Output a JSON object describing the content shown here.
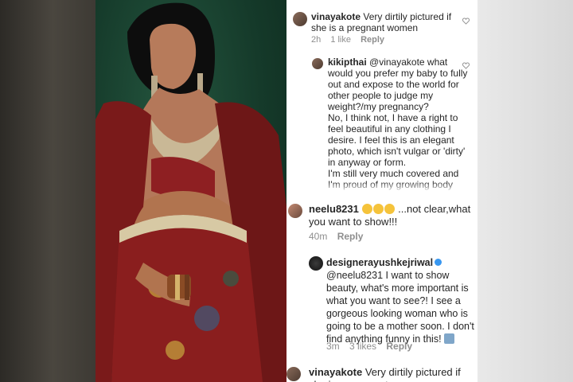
{
  "comments": [
    {
      "user": "vinayakote",
      "text": "Very dirtily pictured if she is a pregnant women",
      "time": "2h",
      "likes": "1 like",
      "reply": "Reply"
    },
    {
      "user": "kikipthai",
      "text": "@vinayakote what would you prefer my baby to fully out and expose to the world for other people to judge my weight?/my pregnancy?",
      "text2": "No, I think not, I have a right to feel beautiful in any clothing I desire. I feel this is an elegant photo, which isn't vulgar or 'dirty' in anyway or form.",
      "text3": "I'm still very much covered and I'm proud of my growing body because I am bringing a beautiful child to this world. And I'm still"
    },
    {
      "user": "neelu8231",
      "text": "...not clear,what you want to show!!!",
      "time": "40m",
      "reply": "Reply"
    },
    {
      "user": "designerayushkejriwal",
      "text": "@neelu8231 I want to show beauty, what's more important is what you want to see?! I see a gorgeous looking woman who is going to be a mother soon. I don't find anything funny in this!",
      "time": "3m",
      "likes": "3 likes",
      "reply": "Reply"
    },
    {
      "user": "vinayakote",
      "text": "Very dirtily pictured if she is a pregnant women"
    }
  ]
}
